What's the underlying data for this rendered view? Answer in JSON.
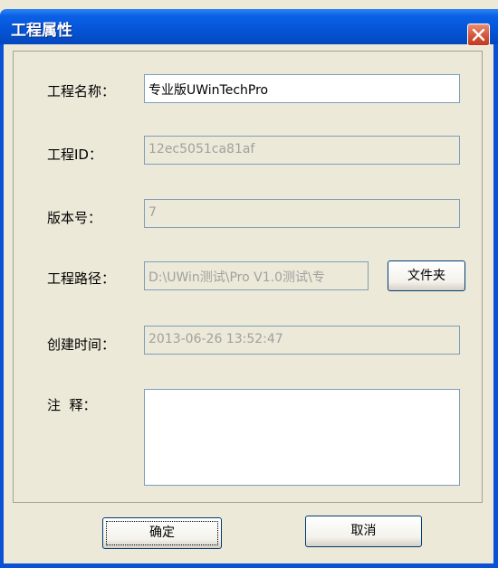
{
  "window": {
    "title": "工程属性",
    "close_icon": "close-icon"
  },
  "form": {
    "name_label": "工程名称：",
    "name_value": "专业版UWinTechPro",
    "id_label": "工程ID：",
    "id_value": "12ec5051ca81af",
    "version_label": "版本号：",
    "version_value": "7",
    "path_label": "工程路径：",
    "path_value": "D:\\UWin测试\\Pro V1.0测试\\专",
    "folder_button": "文件夹",
    "created_label": "创建时间：",
    "created_value": "2013-06-26 13:52:47",
    "remarks_label": "注  释：",
    "remarks_value": ""
  },
  "buttons": {
    "ok": "确定",
    "cancel": "取消"
  },
  "colors": {
    "title_bar": "#0554D6",
    "dialog_bg": "#ECE9D8",
    "close_button": "#D4553A"
  }
}
